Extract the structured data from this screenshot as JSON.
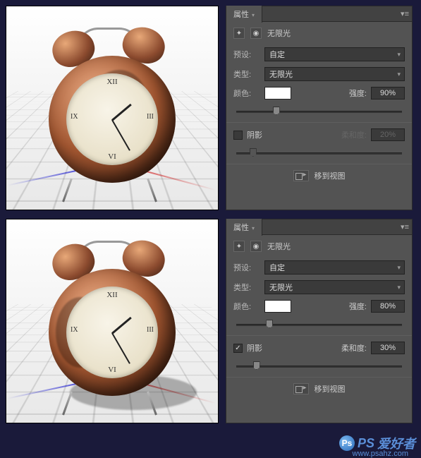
{
  "panel1": {
    "tab": "属性",
    "title": "无限光",
    "preset_label": "预设:",
    "preset_value": "自定",
    "type_label": "类型:",
    "type_value": "无限光",
    "color_label": "颜色:",
    "color_value": "#ffffff",
    "intensity_label": "强度:",
    "intensity_value": "90%",
    "intensity_pct": 90,
    "shadow_checked": false,
    "shadow_label": "阴影",
    "softness_label": "柔和度:",
    "softness_value": "20%",
    "softness_pct": 20,
    "move_label": "移到视图"
  },
  "panel2": {
    "tab": "属性",
    "title": "无限光",
    "preset_label": "预设:",
    "preset_value": "自定",
    "type_label": "类型:",
    "type_value": "无限光",
    "color_label": "颜色:",
    "color_value": "#ffffff",
    "intensity_label": "强度:",
    "intensity_value": "80%",
    "intensity_pct": 80,
    "shadow_checked": true,
    "shadow_label": "阴影",
    "softness_label": "柔和度:",
    "softness_value": "30%",
    "softness_pct": 30,
    "move_label": "移到视图"
  },
  "watermark": {
    "text": "爱好者",
    "prefix": "PS",
    "url": "www.psahz.com"
  }
}
